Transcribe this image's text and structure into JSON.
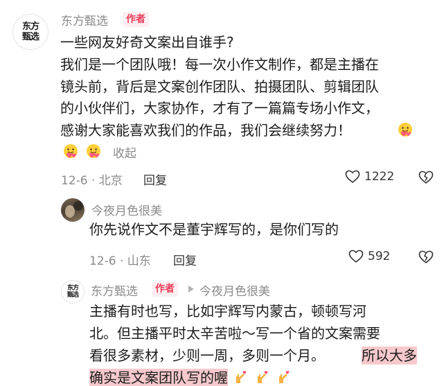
{
  "comments": [
    {
      "author": "东方甄选",
      "avatar_text": [
        "东方",
        "甄选"
      ],
      "author_tag": "作者",
      "lines": [
        "一些网友好奇文案出自谁手?",
        "我们是一个团队哦！每一次小作文制作，都是主播在",
        "镜头前，背后是文案创作团队、拍摄团队、剪辑团队",
        "的小伙伴们，大家协作，才有了一篇篇专场小作文，",
        "感谢大家能喜欢我们的作品，我们会继续努力！"
      ],
      "emoji": "hug-emoji",
      "fold_label": "收起",
      "date": "12-6 · 北京",
      "reply_label": "回复",
      "likes": "1222"
    },
    {
      "author": "今夜月色很美",
      "lines": [
        "你先说作文不是董宇辉写的，是你们写的"
      ],
      "date": "12-6 · 山东",
      "reply_label": "回复",
      "likes": "592"
    },
    {
      "author": "东方甄选",
      "avatar_text": [
        "东方",
        "甄选"
      ],
      "author_tag": "作者",
      "reply_to": "今夜月色很美",
      "lines": [
        "主播有时也写，比如宇辉写内蒙古，顿顿写河",
        "北。但主播平时太辛苦啦～写一个省的文案需要",
        "看很多素材，少则一周，多则一个月。"
      ],
      "highlight_a": "所以大多",
      "highlight_b": "确实是文案团队写的喔",
      "end_emoji": "finger-heart-emoji"
    }
  ],
  "colors": {
    "author_tag_bg": "#fdeff1",
    "author_tag_text": "#ee3a58",
    "highlight": "#f6c9cc",
    "meta_text": "#8a8a8a"
  }
}
